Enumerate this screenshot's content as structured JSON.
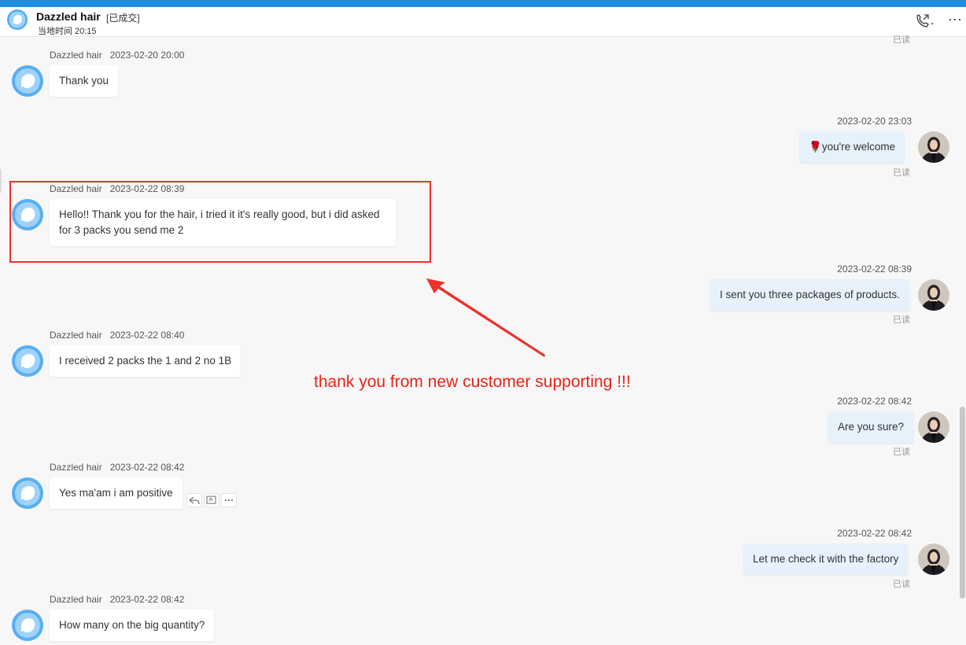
{
  "header": {
    "contact_name": "Dazzled hair",
    "status": "[已成交]",
    "local_time_label": "当地时间",
    "local_time": "20:15"
  },
  "top_read": "已读",
  "messages": [
    {
      "side": "left",
      "name": "Dazzled hair",
      "time": "2023-02-20 20:00",
      "text": "Thank you"
    },
    {
      "side": "right",
      "time": "2023-02-20 23:03",
      "text": "you're welcome",
      "emoji": "🌹",
      "read": "已读"
    },
    {
      "side": "left",
      "name": "Dazzled hair",
      "time": "2023-02-22 08:39",
      "line1": "Hello!! Thank you for the hair, i tried it it's really good, but i did asked",
      "line2": "for 3 packs you send me 2"
    },
    {
      "side": "right",
      "time": "2023-02-22 08:39",
      "text": "I sent you three packages of products.",
      "read": "已读"
    },
    {
      "side": "left",
      "name": "Dazzled hair",
      "time": "2023-02-22 08:40",
      "text": "I received 2 packs the 1 and 2 no 1B"
    },
    {
      "side": "right",
      "time": "2023-02-22 08:42",
      "text": "Are you sure?",
      "read": "已读"
    },
    {
      "side": "left",
      "name": "Dazzled hair",
      "time": "2023-02-22 08:42",
      "text": "Yes ma'am i am positive"
    },
    {
      "side": "right",
      "time": "2023-02-22 08:42",
      "text": "Let me check it with the factory",
      "read": "已读"
    },
    {
      "side": "left",
      "name": "Dazzled hair",
      "time": "2023-02-22 08:42",
      "text": "How many on the big quantity?"
    }
  ],
  "annotation": "thank you from new customer supporting !!!",
  "colors": {
    "accent": "#1e8fe0",
    "highlight": "#f0312b",
    "right_bubble": "#e6f1fc"
  }
}
